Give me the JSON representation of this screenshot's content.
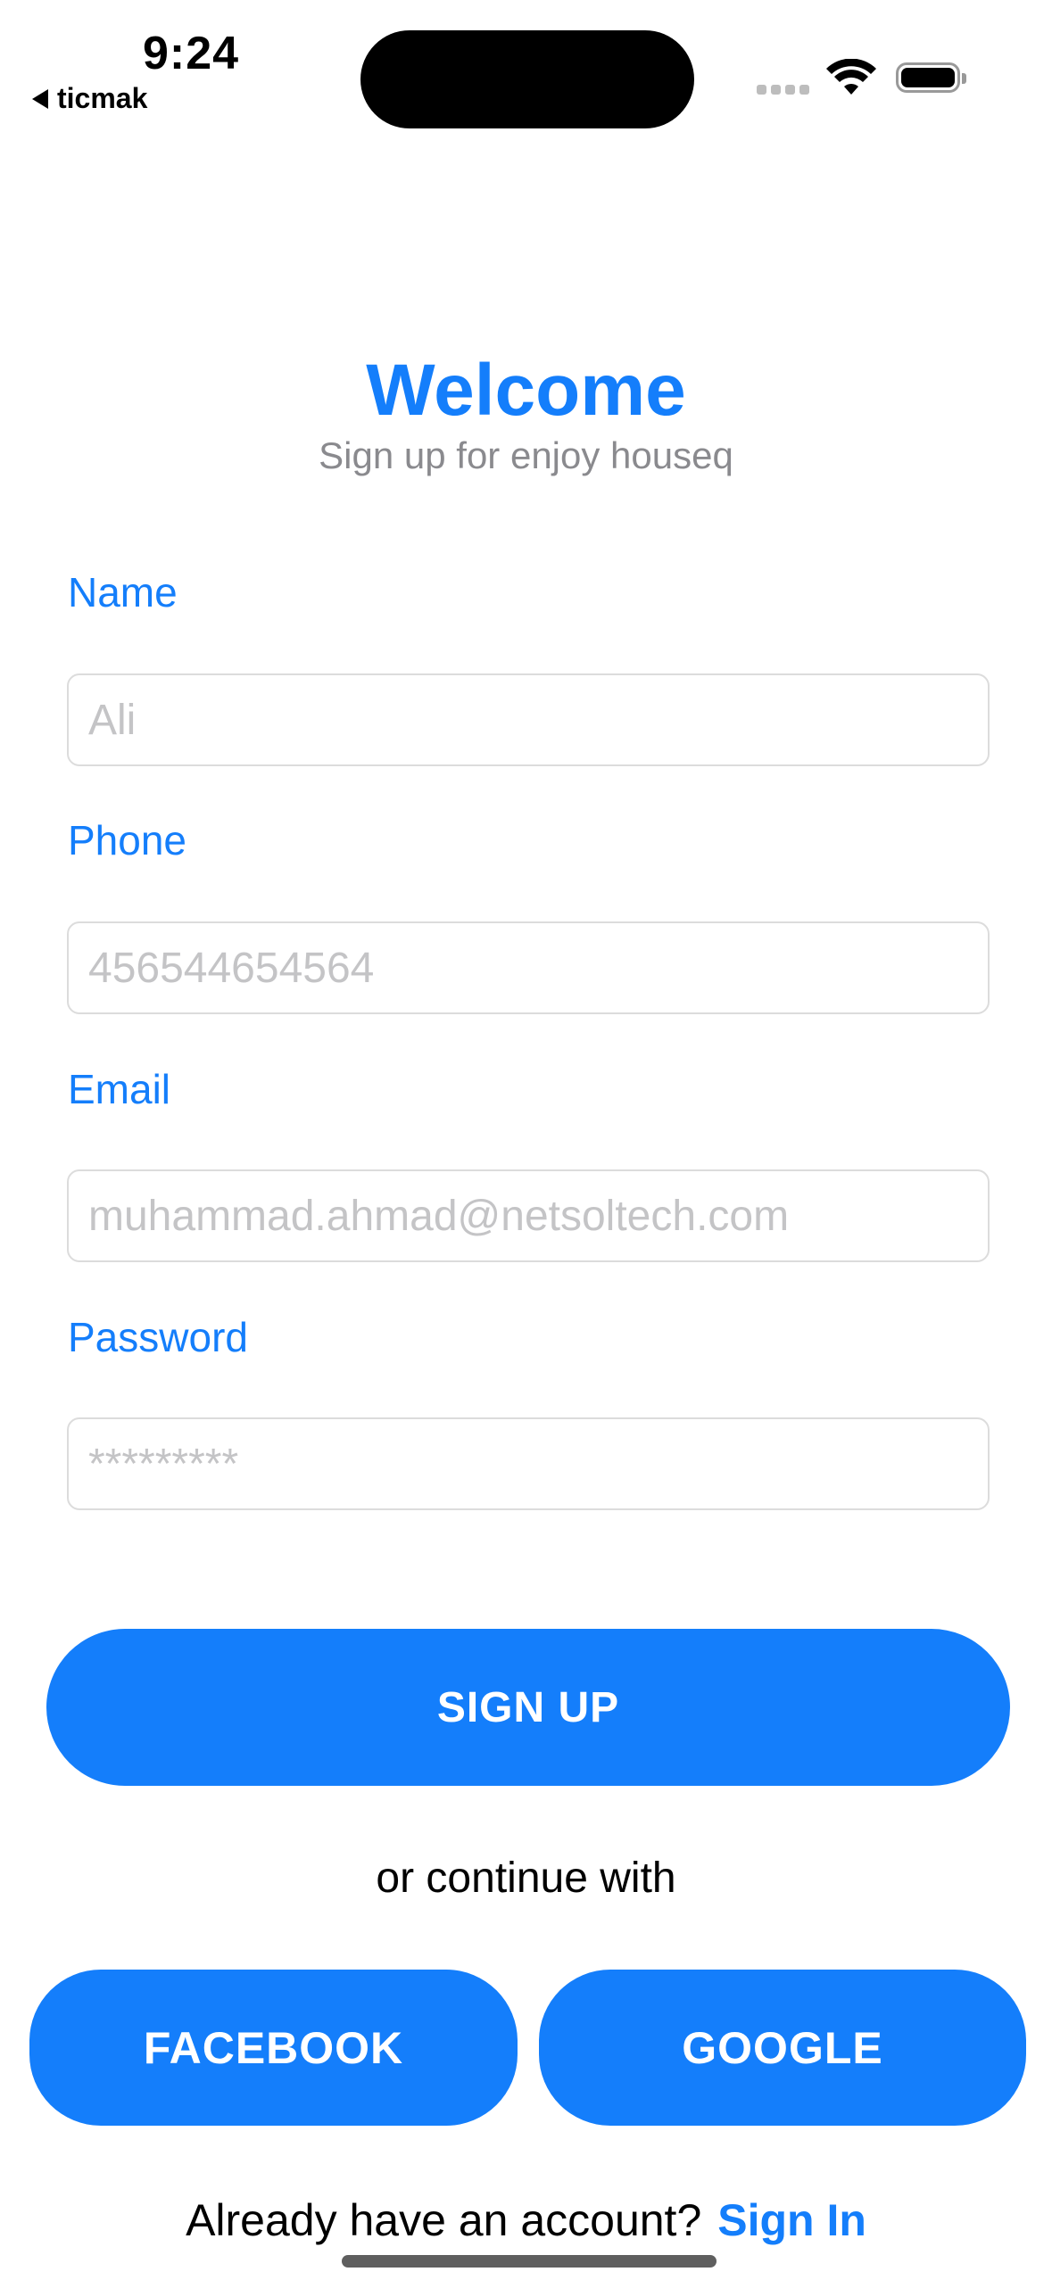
{
  "status_bar": {
    "time": "9:24",
    "back_app": "ticmak",
    "icons": [
      "cellular-icon",
      "wifi-icon",
      "battery-icon"
    ]
  },
  "header": {
    "title": "Welcome",
    "subtitle": "Sign up for enjoy houseq"
  },
  "form": {
    "name": {
      "label": "Name",
      "placeholder": "Ali"
    },
    "phone": {
      "label": "Phone",
      "placeholder": "456544654564"
    },
    "email": {
      "label": "Email",
      "placeholder": "muhammad.ahmad@netsoltech.com"
    },
    "password": {
      "label": "Password",
      "placeholder": "*********"
    }
  },
  "actions": {
    "signup": "SIGN UP",
    "or_continue": "or continue with",
    "facebook": "FACEBOOK",
    "google": "GOOGLE",
    "already": "Already have an account?",
    "signin": "Sign In"
  },
  "colors": {
    "accent": "#147EFB",
    "subtitle": "#8a8a8e",
    "placeholder": "#c4c4c6"
  }
}
